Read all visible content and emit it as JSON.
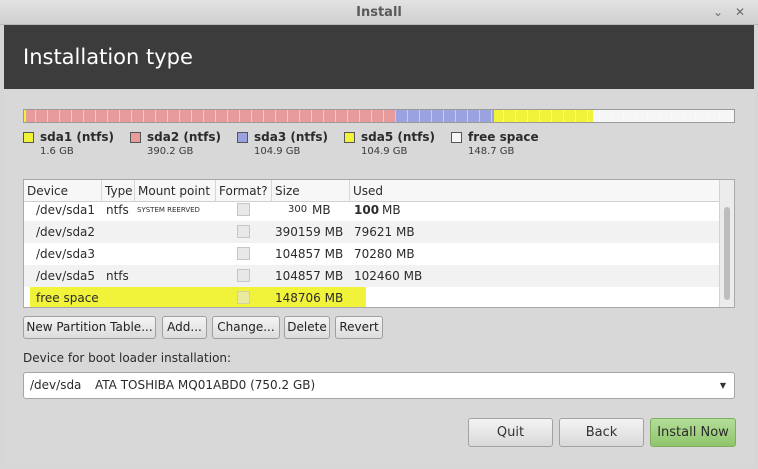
{
  "window": {
    "title": "Install",
    "minimize_glyph": "⌄",
    "close_glyph": "✕"
  },
  "header": {
    "title": "Installation type"
  },
  "colors": {
    "sda1": "#f1f23a",
    "sda2": "#e89b9b",
    "sda3": "#9aa2e0",
    "sda5": "#f1f23a",
    "free": "#f6f6f6",
    "highlight": "#f1f23a",
    "primary_button": "#9fd07d",
    "header_bg": "#3c3c3c"
  },
  "partition_bar": {
    "segments": [
      {
        "id": "sda1",
        "fraction": 0.003
      },
      {
        "id": "sda2",
        "fraction": 0.519
      },
      {
        "id": "sda3",
        "fraction": 0.14
      },
      {
        "id": "sda5",
        "fraction": 0.14
      },
      {
        "id": "free",
        "fraction": 0.198
      }
    ]
  },
  "legend": [
    {
      "name": "sda1 (ntfs)",
      "size": "1.6 GB"
    },
    {
      "name": "sda2 (ntfs)",
      "size": "390.2 GB"
    },
    {
      "name": "sda3 (ntfs)",
      "size": "104.9 GB"
    },
    {
      "name": "sda5 (ntfs)",
      "size": "104.9 GB"
    },
    {
      "name": "free space",
      "size": "148.7 GB"
    }
  ],
  "table": {
    "columns": [
      "Device",
      "Type",
      "Mount point",
      "Format?",
      "Size",
      "Used"
    ],
    "rows": [
      {
        "device": "/dev/sda1",
        "type": "ntfs",
        "mount": "SYSTEM REERVED",
        "size": "300",
        "size_unit": "MB",
        "used": "100",
        "used_unit": "MB"
      },
      {
        "device": "/dev/sda2",
        "type": "",
        "mount": "",
        "size": "390159 MB",
        "used": "79621 MB"
      },
      {
        "device": "/dev/sda3",
        "type": "",
        "mount": "",
        "size": "104857 MB",
        "used": "70280 MB"
      },
      {
        "device": "/dev/sda5",
        "type": "ntfs",
        "mount": "",
        "size": "104857 MB",
        "used": "102460 MB"
      },
      {
        "device": "free space",
        "type": "",
        "mount": "",
        "size": "148706 MB",
        "used": ""
      }
    ]
  },
  "actions": {
    "new_table": "New Partition Table...",
    "add": "Add...",
    "change": "Change...",
    "delete": "Delete",
    "revert": "Revert"
  },
  "bootloader": {
    "label": "Device for boot loader installation:",
    "device": "/dev/sda",
    "disk": "ATA TOSHIBA MQ01ABD0 (750.2 GB)"
  },
  "footer": {
    "quit": "Quit",
    "back": "Back",
    "install": "Install Now"
  }
}
